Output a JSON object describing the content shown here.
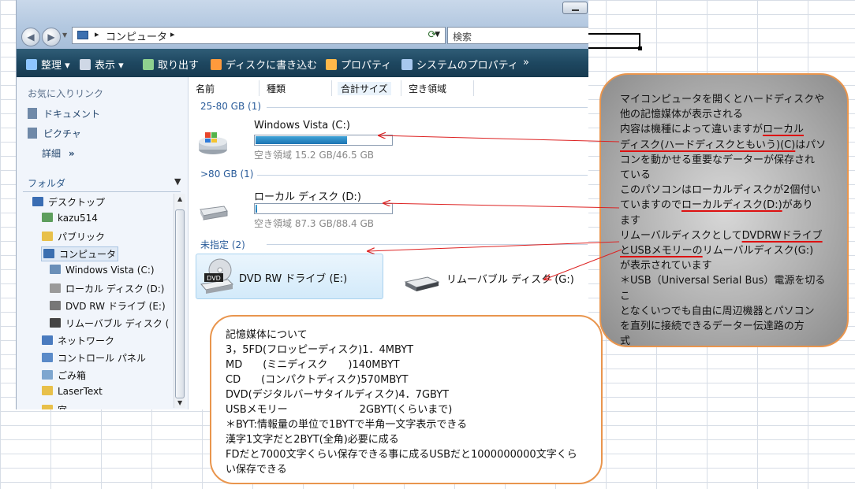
{
  "explorer": {
    "address": {
      "crumb_sep": "▸",
      "location": "コンピュータ"
    },
    "search_placeholder": "検索",
    "toolbar": [
      {
        "label": "整理 ▾",
        "icon": "organize-icon",
        "color": "#8ec5ff"
      },
      {
        "label": "表示 ▾",
        "icon": "views-icon",
        "color": "#cfd8e6"
      },
      {
        "label": "取り出す",
        "icon": "eject-icon",
        "color": "#8fd18f"
      },
      {
        "label": "ディスクに書き込む",
        "icon": "burn-disc-icon",
        "color": "#ff9a3c"
      },
      {
        "label": "プロパティ",
        "icon": "properties-icon",
        "color": "#ffb84a"
      },
      {
        "label": "システムのプロパティ",
        "icon": "system-properties-icon",
        "color": "#a7c8ee"
      },
      {
        "label": "»",
        "icon": "more-icon",
        "color": "#ffffff"
      }
    ],
    "sidebar": {
      "favorites_title": "お気に入りリンク",
      "favorites": [
        {
          "label": "ドキュメント",
          "icon": "documents-icon"
        },
        {
          "label": "ピクチャ",
          "icon": "pictures-icon"
        }
      ],
      "more_label": "詳細",
      "more_chevron": "»",
      "folders_title": "フォルダ",
      "tree": [
        {
          "label": "デスクトップ",
          "icon": "desktop-icon",
          "indent": 0,
          "color": "#3a6db3"
        },
        {
          "label": "kazu514",
          "icon": "user-folder-icon",
          "indent": 1,
          "color": "#5d9e5d"
        },
        {
          "label": "パブリック",
          "icon": "folder-icon",
          "indent": 1,
          "color": "#e8c04a"
        },
        {
          "label": "コンピュータ",
          "icon": "computer-icon",
          "indent": 1,
          "color": "#3b6fb0",
          "selected": true
        },
        {
          "label": "Windows Vista (C:)",
          "icon": "system-drive-icon",
          "indent": 2,
          "color": "#6a8fb8"
        },
        {
          "label": "ローカル ディスク (D:)",
          "icon": "hard-disk-icon",
          "indent": 2,
          "color": "#9a9a9a"
        },
        {
          "label": "DVD RW ドライブ (E:)",
          "icon": "dvd-drive-icon",
          "indent": 2,
          "color": "#777777"
        },
        {
          "label": "リムーバブル ディスク (",
          "icon": "removable-disk-icon",
          "indent": 2,
          "color": "#444444"
        },
        {
          "label": "ネットワーク",
          "icon": "network-icon",
          "indent": 1,
          "color": "#4a7bbf"
        },
        {
          "label": "コントロール パネル",
          "icon": "control-panel-icon",
          "indent": 1,
          "color": "#5a8ac8"
        },
        {
          "label": "ごみ箱",
          "icon": "recycle-bin-icon",
          "indent": 1,
          "color": "#7ea6cf"
        },
        {
          "label": "LaserText",
          "icon": "folder-icon",
          "indent": 1,
          "color": "#e8c04a"
        },
        {
          "label": "宮",
          "icon": "folder-icon",
          "indent": 1,
          "color": "#e8c04a"
        }
      ]
    },
    "columns": [
      "名前",
      "種類",
      "合計サイズ",
      "空き領域"
    ],
    "groups": [
      {
        "label": "25-80 GB (1)"
      },
      {
        "label": ">80 GB (1)"
      },
      {
        "label": "未指定 (2)"
      }
    ],
    "drives": [
      {
        "name": "Windows Vista (C:)",
        "space": "空き領域 15.2 GB/46.5 GB",
        "used_fraction": 0.673
      },
      {
        "name": "ローカル ディスク (D:)",
        "space": "空き領域 87.3 GB/88.4 GB",
        "used_fraction": 0.012
      },
      {
        "name": "DVD RW ドライブ (E:)",
        "badge": "DVD"
      },
      {
        "name": "リムーバブル ディスク (G:)"
      }
    ]
  },
  "callout_right": {
    "lines": [
      [
        {
          "t": "マイコンピュータを開くとハードディスクや"
        }
      ],
      [
        {
          "t": "他の記憶媒体が表示される"
        }
      ],
      [
        {
          "t": "内容は機種によって違いますが"
        },
        {
          "t": "ローカル",
          "u": true
        }
      ],
      [
        {
          "t": "ディスク(ハードディスクともいう)(C)",
          "u": true
        },
        {
          "t": "はパソ"
        }
      ],
      [
        {
          "t": "コンを動かせる重要なデーターが保存され"
        }
      ],
      [
        {
          "t": "ている"
        }
      ],
      [
        {
          "t": "このパソコンはローカルディスクが2個付い"
        }
      ],
      [
        {
          "t": "ていますので"
        },
        {
          "t": "ローカルディスク(D:)",
          "u": true
        },
        {
          "t": "があり"
        }
      ],
      [
        {
          "t": "ます"
        }
      ],
      [
        {
          "t": "リムーバルディスクとして"
        },
        {
          "t": "DVDRWドライブ",
          "u": true
        }
      ],
      [
        {
          "t": "とUSBメモリーの",
          "u": true
        },
        {
          "t": "リムーバルディスク(G:)"
        }
      ],
      [
        {
          "t": "が表示されています"
        }
      ],
      [
        {
          "t": "＊USB（Universal Serial Bus）電源を切るこ"
        }
      ],
      [
        {
          "t": "となくいつでも自由に周辺機器とパソコン"
        }
      ],
      [
        {
          "t": "を直列に接続できるデーター伝達路の方"
        }
      ],
      [
        {
          "t": "式"
        }
      ]
    ]
  },
  "callout_bottom": {
    "lines": [
      "記憶媒体について",
      "3，5FD(フロッピーディスク)1．4MBYT",
      "MD　　(ミニディスク　　)140MBYT",
      "CD　　(コンパクトディスク)570MBYT",
      "DVD(デジタルバーサタイルディスク)4．7GBYT",
      "USBメモリー　　　　　　　2GBYT(くらいまで)",
      "＊BYT:情報量の単位で1BYTで半角一文字表示できる",
      "漢字1文字だと2BYT(全角)必要に成る",
      "FDだと7000文字くらい保存できる事に成るUSBだと1000000000文字くらい保存できる"
    ]
  },
  "colors": {
    "arrow": "#dd2222",
    "callout_border": "#e9954d",
    "toolbar": "#1e4760"
  }
}
